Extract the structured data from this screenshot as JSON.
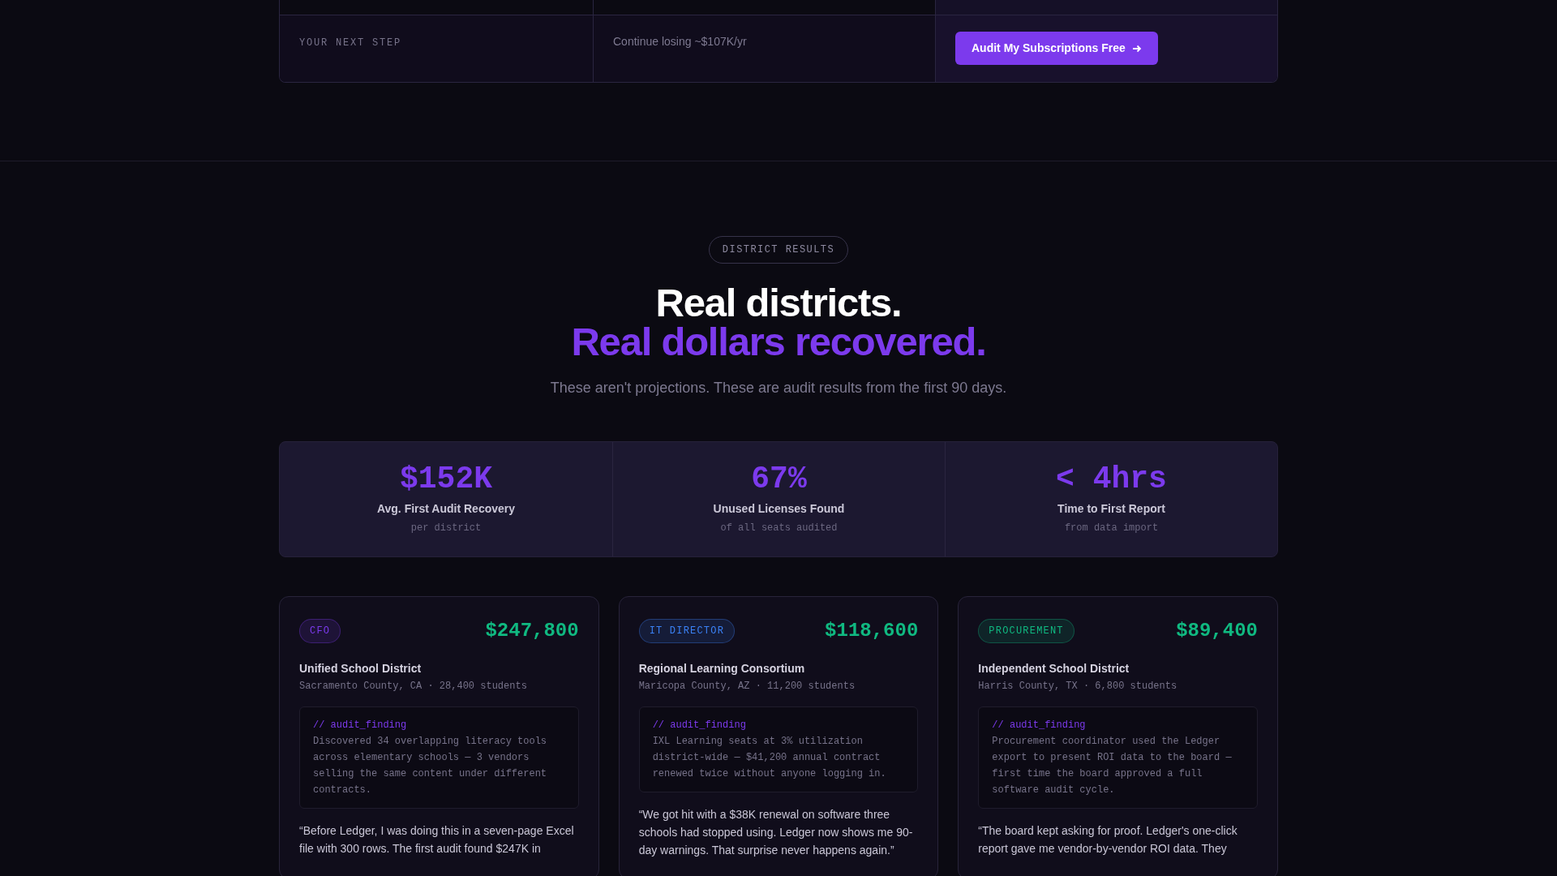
{
  "comparison": {
    "row_label": "YOUR NEXT STEP",
    "current_outcome": "Continue losing ~$107K/yr",
    "cta_button": "Audit My Subscriptions Free"
  },
  "section": {
    "badge": "DISTRICT RESULTS",
    "headline_line_1": "Real districts.",
    "headline_line_2": "Real dollars recovered.",
    "subtitle": "These aren't projections. These are audit results from the first 90 days."
  },
  "stats": [
    {
      "value": "$152K",
      "label": "Avg. First Audit Recovery",
      "sublabel": "per district"
    },
    {
      "value": "67%",
      "label": "Unused Licenses Found",
      "sublabel": "of all seats audited"
    },
    {
      "value": "< 4hrs",
      "label": "Time to First Report",
      "sublabel": "from data import"
    }
  ],
  "cards": [
    {
      "role": "CFO",
      "color": "#7c3aed",
      "amount": "$247,800",
      "district": "Unified School District",
      "meta": "Sacramento County, CA · 28,400 students",
      "finding_label": "// audit_finding",
      "finding": "Discovered 34 overlapping literacy tools across elementary schools — 3 vendors selling the same content under different contracts.",
      "quote": "“Before Ledger, I was doing this in a seven-page Excel file with 300 rows. The first audit found $247K in"
    },
    {
      "role": "IT DIRECTOR",
      "color": "#3b82f6",
      "amount": "$118,600",
      "district": "Regional Learning Consortium",
      "meta": "Maricopa County, AZ · 11,200 students",
      "finding_label": "// audit_finding",
      "finding": "IXL Learning seats at 3% utilization district-wide — $41,200 annual contract renewed twice without anyone logging in.",
      "quote": "“We got hit with a $38K renewal on software three schools had stopped using. Ledger now shows me 90-day warnings. That surprise never happens again.”"
    },
    {
      "role": "PROCUREMENT",
      "color": "#10b981",
      "amount": "$89,400",
      "district": "Independent School District",
      "meta": "Harris County, TX · 6,800 students",
      "finding_label": "// audit_finding",
      "finding": "Procurement coordinator used the Ledger export to present ROI data to the board — first time the board approved a full software audit cycle.",
      "quote": "“The board kept asking for proof. Ledger's one-click report gave me vendor-by-vendor ROI data. They"
    }
  ]
}
